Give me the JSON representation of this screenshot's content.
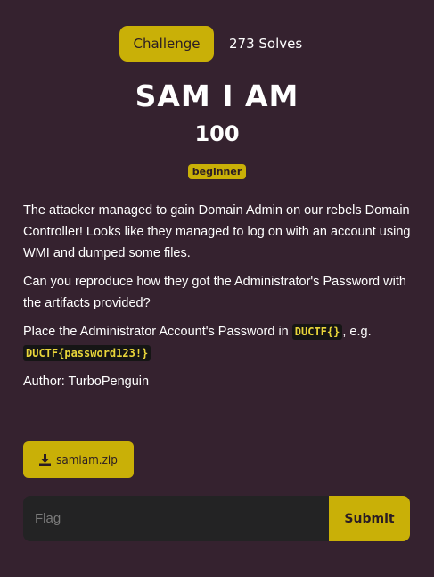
{
  "tabs": {
    "challenge_label": "Challenge",
    "solves_label": "273 Solves"
  },
  "challenge": {
    "title": "SAM I AM",
    "points": "100",
    "tag": "beginner"
  },
  "description": {
    "p1": "The attacker managed to gain Domain Admin on our rebels Domain Controller! Looks like they managed to log on with an account using WMI and dumped some files.",
    "p2": "Can you reproduce how they got the Administrator's Password with the artifacts provided?",
    "p3_prefix": "Place the Administrator Account's Password in ",
    "p3_code1": "DUCTF{}",
    "p3_middle": ", e.g.",
    "p3_code2": "DUCTF{password123!}",
    "author": "Author: TurboPenguin"
  },
  "file": {
    "label": "samiam.zip",
    "icon": "download-icon"
  },
  "flag_form": {
    "placeholder": "Flag",
    "submit_label": "Submit"
  },
  "colors": {
    "background": "#35222f",
    "accent": "#c9b007",
    "input_bg": "#232324",
    "code_bg": "#151515",
    "code_text": "#e9d63a"
  }
}
